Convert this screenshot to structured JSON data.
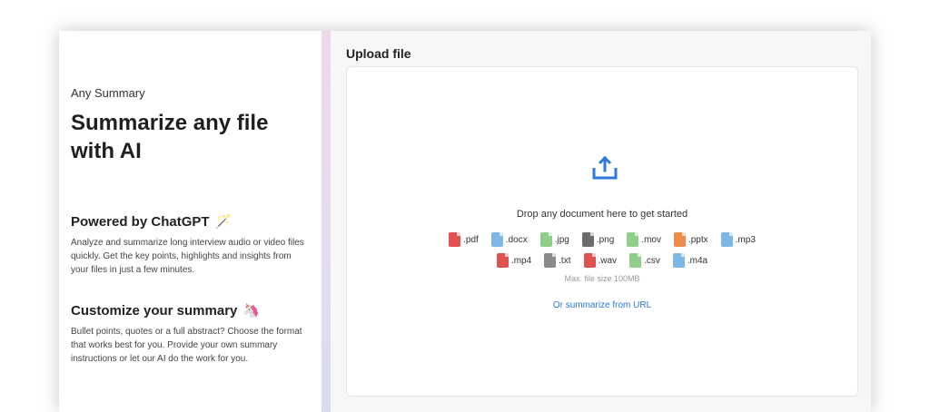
{
  "left": {
    "eyebrow": "Any Summary",
    "headline": "Summarize any file with AI",
    "sections": [
      {
        "title": "Powered by ChatGPT",
        "emoji": "🪄",
        "body": "Analyze and summarize long interview audio or video files quickly. Get the key points, highlights and insights from your files in just a few minutes."
      },
      {
        "title": "Customize your summary",
        "emoji": "🦄",
        "body": "Bullet points, quotes or a full abstract? Choose the format that works best for you. Provide your own summary instructions or let our AI do the work for you."
      }
    ]
  },
  "upload": {
    "title": "Upload file",
    "icon": "upload-icon",
    "drop_text": "Drop any document here to get started",
    "file_types_row1": [
      {
        "label": ".pdf",
        "color": "#e0524f"
      },
      {
        "label": ".docx",
        "color": "#7eb7e6"
      },
      {
        "label": ".jpg",
        "color": "#8fcf8a"
      },
      {
        "label": ".png",
        "color": "#6c6c6c"
      },
      {
        "label": ".mov",
        "color": "#8fcf8a"
      },
      {
        "label": ".pptx",
        "color": "#ee8a4a"
      },
      {
        "label": ".mp3",
        "color": "#7eb7e6"
      }
    ],
    "file_types_row2": [
      {
        "label": ".mp4",
        "color": "#e0524f"
      },
      {
        "label": ".txt",
        "color": "#8a8a8a"
      },
      {
        "label": ".wav",
        "color": "#e0524f"
      },
      {
        "label": ".csv",
        "color": "#8fcf8a"
      },
      {
        "label": ".m4a",
        "color": "#7eb7e6"
      }
    ],
    "max_size": "Max. file size 100MB",
    "url_link": "Or summarize from URL",
    "accent": "#2a7ad8"
  }
}
